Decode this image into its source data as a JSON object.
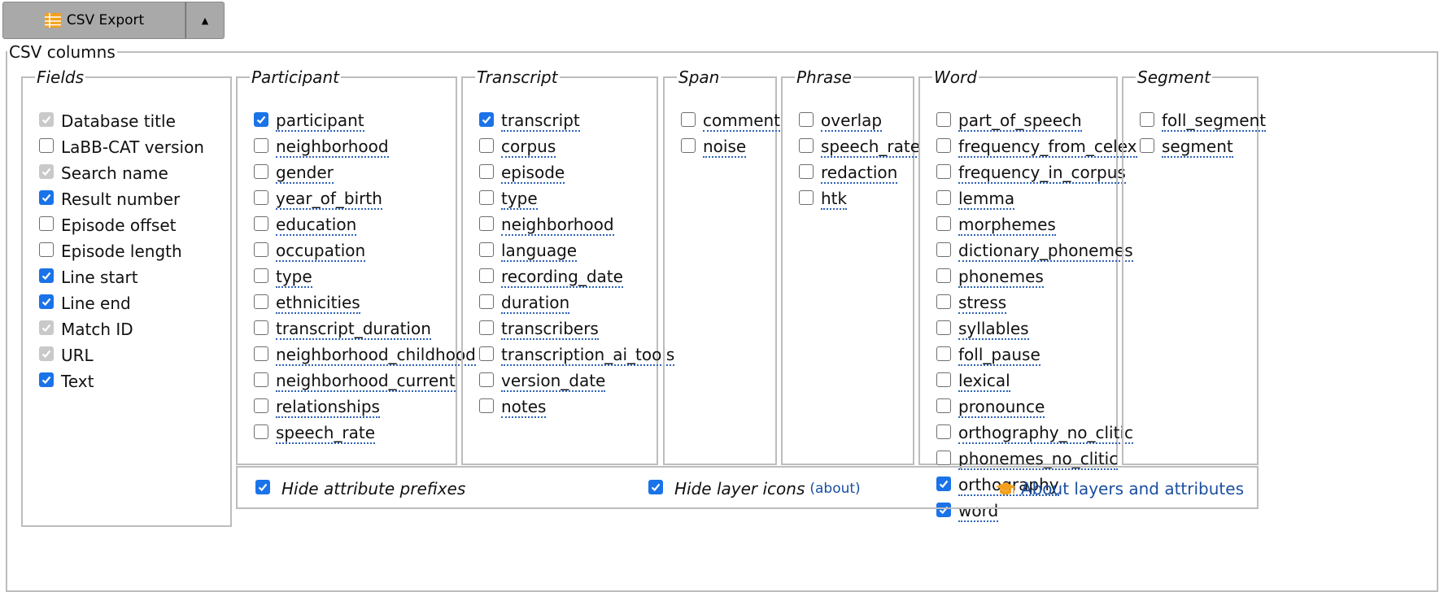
{
  "toolbar": {
    "export_label": "CSV Export",
    "dropdown_arrow": "▲",
    "export_icon": "csv-table-icon"
  },
  "panel": {
    "legend": "CSV columns"
  },
  "groups": [
    {
      "legend": "Fields",
      "items": [
        {
          "label": "Database title",
          "state": "disabled-checked"
        },
        {
          "label": "LaBB-CAT version",
          "state": "unchecked"
        },
        {
          "label": "Search name",
          "state": "disabled-checked"
        },
        {
          "label": "Result number",
          "state": "checked"
        },
        {
          "label": "Episode offset",
          "state": "unchecked"
        },
        {
          "label": "Episode length",
          "state": "unchecked"
        },
        {
          "label": "Line start",
          "state": "checked"
        },
        {
          "label": "Line end",
          "state": "checked"
        },
        {
          "label": "Match ID",
          "state": "disabled-checked"
        },
        {
          "label": "URL",
          "state": "disabled-checked"
        },
        {
          "label": "Text",
          "state": "checked"
        }
      ]
    },
    {
      "legend": "Participant",
      "items": [
        {
          "label": "participant",
          "state": "checked"
        },
        {
          "label": "neighborhood",
          "state": "unchecked"
        },
        {
          "label": "gender",
          "state": "unchecked"
        },
        {
          "label": "year_of_birth",
          "state": "unchecked"
        },
        {
          "label": "education",
          "state": "unchecked"
        },
        {
          "label": "occupation",
          "state": "unchecked"
        },
        {
          "label": "type",
          "state": "unchecked"
        },
        {
          "label": "ethnicities",
          "state": "unchecked"
        },
        {
          "label": "transcript_duration",
          "state": "unchecked"
        },
        {
          "label": "neighborhood_childhood",
          "state": "unchecked"
        },
        {
          "label": "neighborhood_current",
          "state": "unchecked"
        },
        {
          "label": "relationships",
          "state": "unchecked"
        },
        {
          "label": "speech_rate",
          "state": "unchecked"
        }
      ]
    },
    {
      "legend": "Transcript",
      "items": [
        {
          "label": "transcript",
          "state": "checked"
        },
        {
          "label": "corpus",
          "state": "unchecked"
        },
        {
          "label": "episode",
          "state": "unchecked"
        },
        {
          "label": "type",
          "state": "unchecked"
        },
        {
          "label": "neighborhood",
          "state": "unchecked"
        },
        {
          "label": "language",
          "state": "unchecked"
        },
        {
          "label": "recording_date",
          "state": "unchecked"
        },
        {
          "label": "duration",
          "state": "unchecked"
        },
        {
          "label": "transcribers",
          "state": "unchecked"
        },
        {
          "label": "transcription_ai_tools",
          "state": "unchecked"
        },
        {
          "label": "version_date",
          "state": "unchecked"
        },
        {
          "label": "notes",
          "state": "unchecked"
        }
      ]
    },
    {
      "legend": "Span",
      "items": [
        {
          "label": "comment",
          "state": "unchecked"
        },
        {
          "label": "noise",
          "state": "unchecked"
        }
      ]
    },
    {
      "legend": "Phrase",
      "items": [
        {
          "label": "overlap",
          "state": "unchecked"
        },
        {
          "label": "speech_rate",
          "state": "unchecked"
        },
        {
          "label": "redaction",
          "state": "unchecked"
        },
        {
          "label": "htk",
          "state": "unchecked"
        }
      ]
    },
    {
      "legend": "Word",
      "items": [
        {
          "label": "part_of_speech",
          "state": "unchecked"
        },
        {
          "label": "frequency_from_celex",
          "state": "unchecked"
        },
        {
          "label": "frequency_in_corpus",
          "state": "unchecked"
        },
        {
          "label": "lemma",
          "state": "unchecked"
        },
        {
          "label": "morphemes",
          "state": "unchecked"
        },
        {
          "label": "dictionary_phonemes",
          "state": "unchecked"
        },
        {
          "label": "phonemes",
          "state": "unchecked"
        },
        {
          "label": "stress",
          "state": "unchecked"
        },
        {
          "label": "syllables",
          "state": "unchecked"
        },
        {
          "label": "foll_pause",
          "state": "unchecked"
        },
        {
          "label": "lexical",
          "state": "unchecked"
        },
        {
          "label": "pronounce",
          "state": "unchecked"
        },
        {
          "label": "orthography_no_clitic",
          "state": "unchecked"
        },
        {
          "label": "phonemes_no_clitic",
          "state": "unchecked"
        },
        {
          "label": "orthography",
          "state": "checked"
        },
        {
          "label": "word",
          "state": "checked"
        }
      ]
    },
    {
      "legend": "Segment",
      "items": [
        {
          "label": "foll_segment",
          "state": "unchecked"
        },
        {
          "label": "segment",
          "state": "unchecked"
        }
      ]
    }
  ],
  "options": {
    "hide_prefixes": {
      "label": "Hide attribute prefixes",
      "checked": true
    },
    "hide_icons": {
      "label": "Hide layer icons",
      "checked": true,
      "about": "(about)"
    },
    "about_layers": {
      "label": "About layers and attributes",
      "icon": "graduation-cap-icon"
    }
  },
  "colors": {
    "accent": "#1a73e8",
    "link": "#1a4fa0",
    "icon_orange": "#f2a01b",
    "button_gray": "#a9a9a9"
  }
}
